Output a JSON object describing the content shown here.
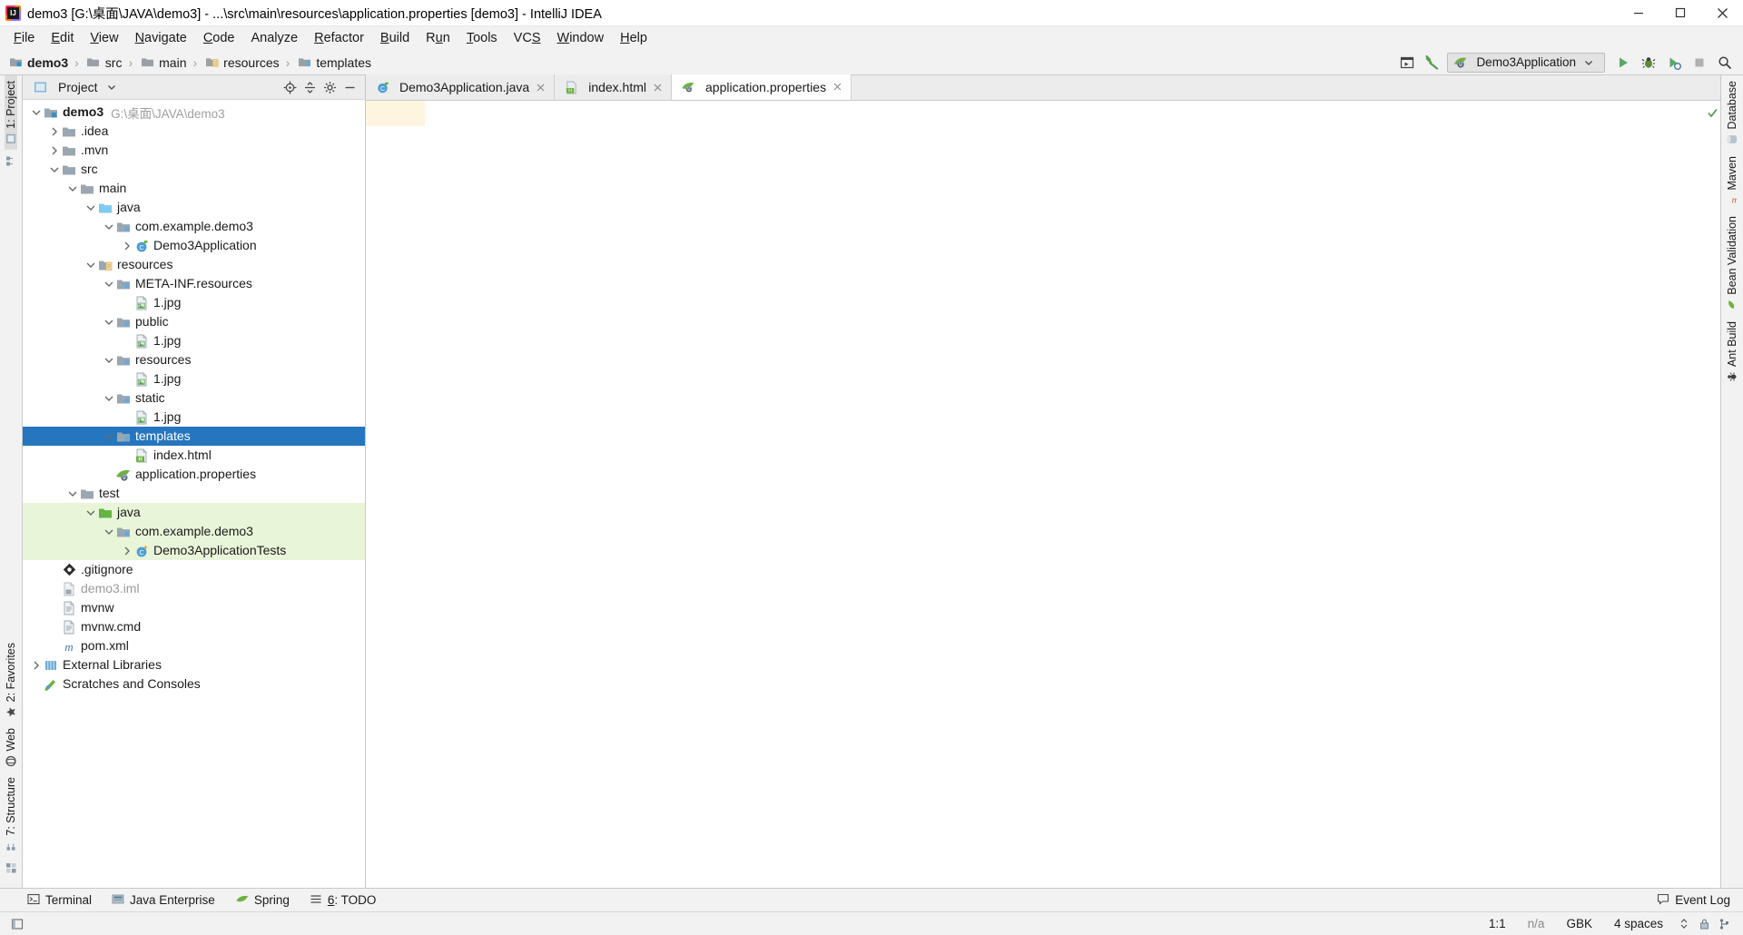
{
  "window": {
    "title": "demo3 [G:\\桌面\\JAVA\\demo3] - ...\\src\\main\\resources\\application.properties [demo3] - IntelliJ IDEA",
    "app_icon": "intellij-idea-icon",
    "minimize_label": "Minimize",
    "maximize_label": "Maximize",
    "close_label": "Close"
  },
  "menu": {
    "items": [
      {
        "label": "File",
        "mnemonic": "F"
      },
      {
        "label": "Edit",
        "mnemonic": "E"
      },
      {
        "label": "View",
        "mnemonic": "V"
      },
      {
        "label": "Navigate",
        "mnemonic": "N"
      },
      {
        "label": "Code",
        "mnemonic": "C"
      },
      {
        "label": "Analyze",
        "mnemonic": ""
      },
      {
        "label": "Refactor",
        "mnemonic": "R"
      },
      {
        "label": "Build",
        "mnemonic": "B"
      },
      {
        "label": "Run",
        "mnemonic": "u"
      },
      {
        "label": "Tools",
        "mnemonic": "T"
      },
      {
        "label": "VCS",
        "mnemonic": "S"
      },
      {
        "label": "Window",
        "mnemonic": "W"
      },
      {
        "label": "Help",
        "mnemonic": "H"
      }
    ]
  },
  "breadcrumb": {
    "items": [
      {
        "label": "demo3",
        "icon": "module-folder-icon",
        "bold": true
      },
      {
        "label": "src",
        "icon": "folder-icon",
        "bold": false
      },
      {
        "label": "main",
        "icon": "folder-icon",
        "bold": false
      },
      {
        "label": "resources",
        "icon": "resources-folder-icon",
        "bold": false
      },
      {
        "label": "templates",
        "icon": "folder-icon",
        "bold": false
      }
    ],
    "separator": "›"
  },
  "toolbar": {
    "select_in_icon": "select-opened-file-icon",
    "build_icon": "build-hammer-icon",
    "run_config_name": "Demo3Application",
    "run_config_icon": "spring-boot-icon",
    "run_icon": "run-green-arrow-icon",
    "debug_icon": "debug-bug-icon",
    "run_coverage_icon": "run-with-coverage-icon",
    "stop_icon": "stop-square-icon",
    "search_icon": "search-everywhere-icon"
  },
  "left_strip": {
    "top": [
      {
        "label": "1: Project",
        "icon": "project-icon",
        "selected": true
      },
      {
        "label": "",
        "icon": "structure-small-icon",
        "selected": false
      }
    ],
    "bottom": [
      {
        "label": "2: Favorites",
        "icon": "favorites-star-icon",
        "selected": false
      },
      {
        "label": "Web",
        "icon": "web-globe-icon",
        "selected": false
      },
      {
        "label": "7: Structure",
        "icon": "structure-icon",
        "selected": false
      }
    ]
  },
  "right_strip": {
    "items": [
      {
        "label": "Database",
        "icon": "database-icon"
      },
      {
        "label": "Maven",
        "icon": "maven-m-icon"
      },
      {
        "label": "Bean Validation",
        "icon": "bean-validation-icon"
      },
      {
        "label": "Ant Build",
        "icon": "ant-build-icon"
      }
    ]
  },
  "project_panel": {
    "title": "Project",
    "dropdown_icon": "chevron-down-icon",
    "panel_icon": "project-view-icon",
    "actions": [
      {
        "name": "scroll-from-source-icon"
      },
      {
        "name": "collapse-all-icon"
      },
      {
        "name": "settings-gear-icon"
      },
      {
        "name": "hide-panel-icon"
      }
    ],
    "tree": [
      {
        "depth": 0,
        "label": "demo3",
        "path": "G:\\桌面\\JAVA\\demo3",
        "icon": "module-folder-icon",
        "arrow": "down",
        "bold": true,
        "state": "normal"
      },
      {
        "depth": 1,
        "label": ".idea",
        "icon": "folder-icon",
        "arrow": "right",
        "state": "normal"
      },
      {
        "depth": 1,
        "label": ".mvn",
        "icon": "folder-icon",
        "arrow": "right",
        "state": "normal"
      },
      {
        "depth": 1,
        "label": "src",
        "icon": "folder-icon",
        "arrow": "down",
        "state": "normal"
      },
      {
        "depth": 2,
        "label": "main",
        "icon": "folder-icon",
        "arrow": "down",
        "state": "normal"
      },
      {
        "depth": 3,
        "label": "java",
        "icon": "source-root-folder-icon",
        "arrow": "down",
        "state": "normal"
      },
      {
        "depth": 4,
        "label": "com.example.demo3",
        "icon": "package-folder-icon",
        "arrow": "down",
        "state": "normal"
      },
      {
        "depth": 5,
        "label": "Demo3Application",
        "icon": "spring-class-icon",
        "arrow": "right",
        "state": "normal"
      },
      {
        "depth": 3,
        "label": "resources",
        "icon": "resources-root-folder-icon",
        "arrow": "down",
        "state": "normal"
      },
      {
        "depth": 4,
        "label": "META-INF.resources",
        "icon": "package-folder-icon",
        "arrow": "down",
        "state": "normal"
      },
      {
        "depth": 5,
        "label": "1.jpg",
        "icon": "image-file-icon",
        "arrow": "none",
        "state": "normal"
      },
      {
        "depth": 4,
        "label": "public",
        "icon": "package-folder-icon",
        "arrow": "down",
        "state": "normal"
      },
      {
        "depth": 5,
        "label": "1.jpg",
        "icon": "image-file-icon",
        "arrow": "none",
        "state": "normal"
      },
      {
        "depth": 4,
        "label": "resources",
        "icon": "package-folder-icon",
        "arrow": "down",
        "state": "normal"
      },
      {
        "depth": 5,
        "label": "1.jpg",
        "icon": "image-file-icon",
        "arrow": "none",
        "state": "normal"
      },
      {
        "depth": 4,
        "label": "static",
        "icon": "package-folder-icon",
        "arrow": "down",
        "state": "normal"
      },
      {
        "depth": 5,
        "label": "1.jpg",
        "icon": "image-file-icon",
        "arrow": "none",
        "state": "normal"
      },
      {
        "depth": 4,
        "label": "templates",
        "icon": "package-folder-icon",
        "arrow": "down",
        "state": "selected"
      },
      {
        "depth": 5,
        "label": "index.html",
        "icon": "html-file-icon",
        "arrow": "none",
        "state": "normal"
      },
      {
        "depth": 4,
        "label": "application.properties",
        "icon": "spring-properties-icon",
        "arrow": "none",
        "state": "normal"
      },
      {
        "depth": 2,
        "label": "test",
        "icon": "folder-icon",
        "arrow": "down",
        "state": "normal"
      },
      {
        "depth": 3,
        "label": "java",
        "icon": "test-source-root-folder-icon",
        "arrow": "down",
        "state": "green"
      },
      {
        "depth": 4,
        "label": "com.example.demo3",
        "icon": "package-folder-icon",
        "arrow": "down",
        "state": "green"
      },
      {
        "depth": 5,
        "label": "Demo3ApplicationTests",
        "icon": "test-class-icon",
        "arrow": "right",
        "state": "green"
      },
      {
        "depth": 1,
        "label": ".gitignore",
        "icon": "git-file-icon",
        "arrow": "none",
        "state": "normal"
      },
      {
        "depth": 1,
        "label": "demo3.iml",
        "icon": "iml-file-icon",
        "arrow": "none",
        "state": "dim"
      },
      {
        "depth": 1,
        "label": "mvnw",
        "icon": "file-icon",
        "arrow": "none",
        "state": "normal"
      },
      {
        "depth": 1,
        "label": "mvnw.cmd",
        "icon": "file-icon",
        "arrow": "none",
        "state": "normal"
      },
      {
        "depth": 1,
        "label": "pom.xml",
        "icon": "maven-pom-icon",
        "arrow": "none",
        "state": "normal"
      },
      {
        "depth": 0,
        "label": "External Libraries",
        "icon": "external-libraries-icon",
        "arrow": "right",
        "state": "normal"
      },
      {
        "depth": 0,
        "label": "Scratches and Consoles",
        "icon": "scratches-icon",
        "arrow": "none",
        "state": "normal"
      }
    ]
  },
  "editor": {
    "tabs": [
      {
        "label": "Demo3Application.java",
        "icon": "spring-class-icon",
        "active": false
      },
      {
        "label": "index.html",
        "icon": "html-file-icon",
        "active": false
      },
      {
        "label": "application.properties",
        "icon": "spring-properties-icon",
        "active": true
      }
    ],
    "close_icon": "close-x-icon",
    "content": "",
    "inspection_status_icon": "inspections-ok-checkmark-icon"
  },
  "bottom_bar": {
    "tools": [
      {
        "label": "Terminal",
        "icon": "terminal-icon",
        "mnemonic": ""
      },
      {
        "label": "Java Enterprise",
        "icon": "java-enterprise-icon",
        "mnemonic": ""
      },
      {
        "label": "Spring",
        "icon": "spring-leaf-icon",
        "mnemonic": ""
      },
      {
        "label": "6: TODO",
        "icon": "todo-list-icon",
        "mnemonic": "6"
      }
    ],
    "event_log": {
      "label": "Event Log",
      "icon": "event-log-balloon-icon"
    }
  },
  "status_bar": {
    "left_icon": "toggle-toolbar-icon",
    "caret_position": "1:1",
    "line_separator": "n/a",
    "encoding": "GBK",
    "indent": "4 spaces",
    "indent_chevron": "chevron-updown-icon",
    "lock_icon": "read-only-lock-icon",
    "vcs_icon": "vcs-branch-icon"
  },
  "colors": {
    "selection_blue": "#2675bf",
    "test_green_bg": "#e9f5d9",
    "source_root_blue": "#7fcaf0",
    "test_root_green": "#62b543",
    "accent_orange": "#f97a12",
    "panel_bg": "#f2f2f2",
    "editor_bg": "#ffffff",
    "gutter_highlight": "#fdf5e0"
  }
}
